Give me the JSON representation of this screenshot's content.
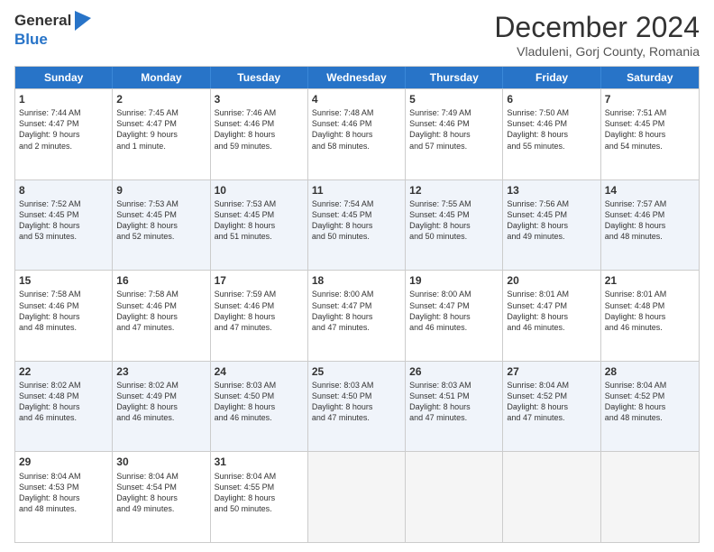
{
  "header": {
    "logo_general": "General",
    "logo_blue": "Blue",
    "month_title": "December 2024",
    "subtitle": "Vladuleni, Gorj County, Romania"
  },
  "weekdays": [
    "Sunday",
    "Monday",
    "Tuesday",
    "Wednesday",
    "Thursday",
    "Friday",
    "Saturday"
  ],
  "rows": [
    [
      {
        "day": "1",
        "lines": [
          "Sunrise: 7:44 AM",
          "Sunset: 4:47 PM",
          "Daylight: 9 hours",
          "and 2 minutes."
        ]
      },
      {
        "day": "2",
        "lines": [
          "Sunrise: 7:45 AM",
          "Sunset: 4:47 PM",
          "Daylight: 9 hours",
          "and 1 minute."
        ]
      },
      {
        "day": "3",
        "lines": [
          "Sunrise: 7:46 AM",
          "Sunset: 4:46 PM",
          "Daylight: 8 hours",
          "and 59 minutes."
        ]
      },
      {
        "day": "4",
        "lines": [
          "Sunrise: 7:48 AM",
          "Sunset: 4:46 PM",
          "Daylight: 8 hours",
          "and 58 minutes."
        ]
      },
      {
        "day": "5",
        "lines": [
          "Sunrise: 7:49 AM",
          "Sunset: 4:46 PM",
          "Daylight: 8 hours",
          "and 57 minutes."
        ]
      },
      {
        "day": "6",
        "lines": [
          "Sunrise: 7:50 AM",
          "Sunset: 4:46 PM",
          "Daylight: 8 hours",
          "and 55 minutes."
        ]
      },
      {
        "day": "7",
        "lines": [
          "Sunrise: 7:51 AM",
          "Sunset: 4:45 PM",
          "Daylight: 8 hours",
          "and 54 minutes."
        ]
      }
    ],
    [
      {
        "day": "8",
        "lines": [
          "Sunrise: 7:52 AM",
          "Sunset: 4:45 PM",
          "Daylight: 8 hours",
          "and 53 minutes."
        ]
      },
      {
        "day": "9",
        "lines": [
          "Sunrise: 7:53 AM",
          "Sunset: 4:45 PM",
          "Daylight: 8 hours",
          "and 52 minutes."
        ]
      },
      {
        "day": "10",
        "lines": [
          "Sunrise: 7:53 AM",
          "Sunset: 4:45 PM",
          "Daylight: 8 hours",
          "and 51 minutes."
        ]
      },
      {
        "day": "11",
        "lines": [
          "Sunrise: 7:54 AM",
          "Sunset: 4:45 PM",
          "Daylight: 8 hours",
          "and 50 minutes."
        ]
      },
      {
        "day": "12",
        "lines": [
          "Sunrise: 7:55 AM",
          "Sunset: 4:45 PM",
          "Daylight: 8 hours",
          "and 50 minutes."
        ]
      },
      {
        "day": "13",
        "lines": [
          "Sunrise: 7:56 AM",
          "Sunset: 4:45 PM",
          "Daylight: 8 hours",
          "and 49 minutes."
        ]
      },
      {
        "day": "14",
        "lines": [
          "Sunrise: 7:57 AM",
          "Sunset: 4:46 PM",
          "Daylight: 8 hours",
          "and 48 minutes."
        ]
      }
    ],
    [
      {
        "day": "15",
        "lines": [
          "Sunrise: 7:58 AM",
          "Sunset: 4:46 PM",
          "Daylight: 8 hours",
          "and 48 minutes."
        ]
      },
      {
        "day": "16",
        "lines": [
          "Sunrise: 7:58 AM",
          "Sunset: 4:46 PM",
          "Daylight: 8 hours",
          "and 47 minutes."
        ]
      },
      {
        "day": "17",
        "lines": [
          "Sunrise: 7:59 AM",
          "Sunset: 4:46 PM",
          "Daylight: 8 hours",
          "and 47 minutes."
        ]
      },
      {
        "day": "18",
        "lines": [
          "Sunrise: 8:00 AM",
          "Sunset: 4:47 PM",
          "Daylight: 8 hours",
          "and 47 minutes."
        ]
      },
      {
        "day": "19",
        "lines": [
          "Sunrise: 8:00 AM",
          "Sunset: 4:47 PM",
          "Daylight: 8 hours",
          "and 46 minutes."
        ]
      },
      {
        "day": "20",
        "lines": [
          "Sunrise: 8:01 AM",
          "Sunset: 4:47 PM",
          "Daylight: 8 hours",
          "and 46 minutes."
        ]
      },
      {
        "day": "21",
        "lines": [
          "Sunrise: 8:01 AM",
          "Sunset: 4:48 PM",
          "Daylight: 8 hours",
          "and 46 minutes."
        ]
      }
    ],
    [
      {
        "day": "22",
        "lines": [
          "Sunrise: 8:02 AM",
          "Sunset: 4:48 PM",
          "Daylight: 8 hours",
          "and 46 minutes."
        ]
      },
      {
        "day": "23",
        "lines": [
          "Sunrise: 8:02 AM",
          "Sunset: 4:49 PM",
          "Daylight: 8 hours",
          "and 46 minutes."
        ]
      },
      {
        "day": "24",
        "lines": [
          "Sunrise: 8:03 AM",
          "Sunset: 4:50 PM",
          "Daylight: 8 hours",
          "and 46 minutes."
        ]
      },
      {
        "day": "25",
        "lines": [
          "Sunrise: 8:03 AM",
          "Sunset: 4:50 PM",
          "Daylight: 8 hours",
          "and 47 minutes."
        ]
      },
      {
        "day": "26",
        "lines": [
          "Sunrise: 8:03 AM",
          "Sunset: 4:51 PM",
          "Daylight: 8 hours",
          "and 47 minutes."
        ]
      },
      {
        "day": "27",
        "lines": [
          "Sunrise: 8:04 AM",
          "Sunset: 4:52 PM",
          "Daylight: 8 hours",
          "and 47 minutes."
        ]
      },
      {
        "day": "28",
        "lines": [
          "Sunrise: 8:04 AM",
          "Sunset: 4:52 PM",
          "Daylight: 8 hours",
          "and 48 minutes."
        ]
      }
    ],
    [
      {
        "day": "29",
        "lines": [
          "Sunrise: 8:04 AM",
          "Sunset: 4:53 PM",
          "Daylight: 8 hours",
          "and 48 minutes."
        ]
      },
      {
        "day": "30",
        "lines": [
          "Sunrise: 8:04 AM",
          "Sunset: 4:54 PM",
          "Daylight: 8 hours",
          "and 49 minutes."
        ]
      },
      {
        "day": "31",
        "lines": [
          "Sunrise: 8:04 AM",
          "Sunset: 4:55 PM",
          "Daylight: 8 hours",
          "and 50 minutes."
        ]
      },
      {
        "day": "",
        "lines": []
      },
      {
        "day": "",
        "lines": []
      },
      {
        "day": "",
        "lines": []
      },
      {
        "day": "",
        "lines": []
      }
    ]
  ],
  "alt_rows": [
    1,
    3
  ]
}
